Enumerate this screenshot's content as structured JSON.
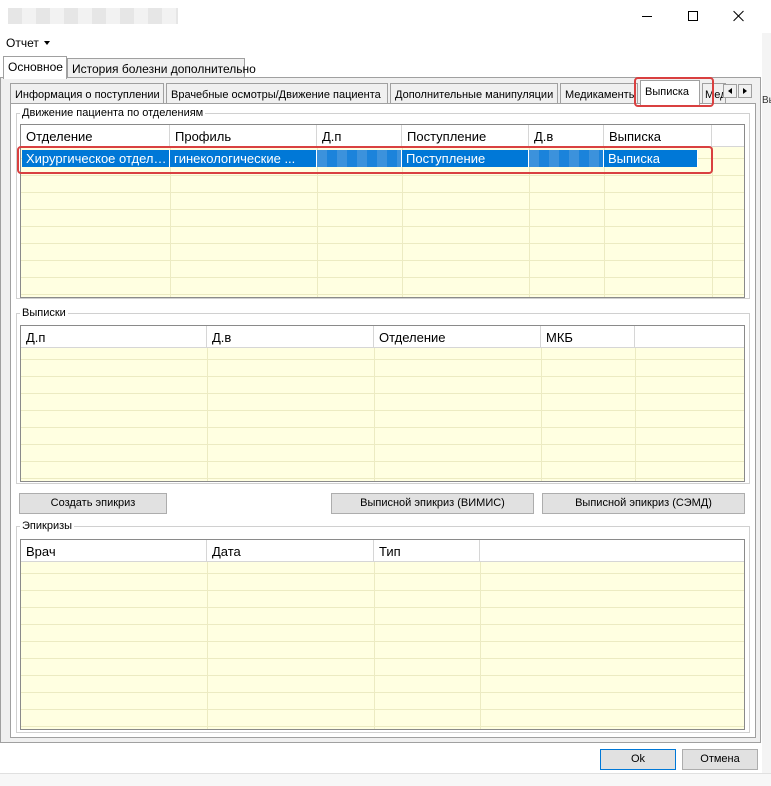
{
  "menu": {
    "report_label": "Отчет"
  },
  "outer_tabs": [
    {
      "label": "Основное"
    },
    {
      "label": "История болезни дополнительно"
    }
  ],
  "inner_tabs": [
    {
      "label": "Информация о поступлении"
    },
    {
      "label": "Врачебные осмотры/Движение пациента"
    },
    {
      "label": "Дополнительные манипуляции"
    },
    {
      "label": "Медикаменты"
    },
    {
      "label": "Выписка"
    },
    {
      "label": "Мед"
    }
  ],
  "movement": {
    "group_label": "Движение пациента по отделениям",
    "columns": [
      "Отделение",
      "Профиль",
      "Д.п",
      "Поступление",
      "Д.в",
      "Выписка"
    ],
    "row": {
      "department": "Хирургическое отделение",
      "profile": "гинекологические ...",
      "admission": "Поступление",
      "discharge": "Выписка"
    }
  },
  "discharges": {
    "group_label": "Выписки",
    "columns": [
      "Д.п",
      "Д.в",
      "Отделение",
      "МКБ"
    ]
  },
  "buttons": {
    "create_epicrisis": "Создать эпикриз",
    "epicrisis_vimis": "Выписной эпикриз (ВИМИС)",
    "epicrisis_semd": "Выписной эпикриз (СЭМД)",
    "ok": "Ok",
    "cancel": "Отмена"
  },
  "epicrises": {
    "group_label": "Эпикризы",
    "columns": [
      "Врач",
      "Дата",
      "Тип"
    ]
  },
  "side_hint": "Вы"
}
